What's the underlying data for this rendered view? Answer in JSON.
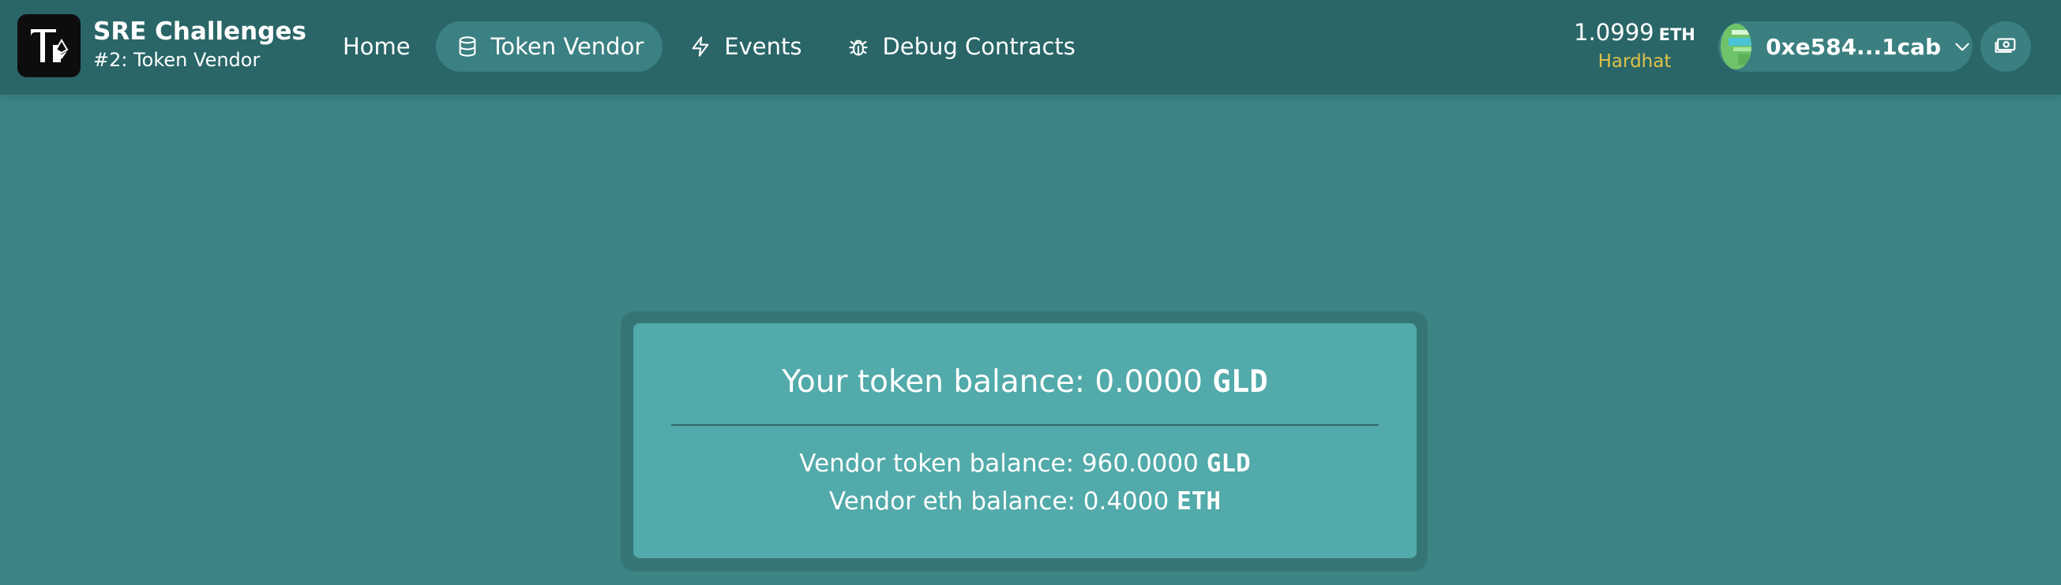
{
  "colors": {
    "background": "#3d8585",
    "header": "#2a6668",
    "active_nav": "#3b8082",
    "card": "#52aaaa",
    "network_label": "#e0c24a"
  },
  "brand": {
    "title": "SRE Challenges",
    "subtitle": "#2: Token Vendor"
  },
  "nav": [
    {
      "label": "Home",
      "icon": "none",
      "active": false
    },
    {
      "label": "Token Vendor",
      "icon": "database-icon",
      "active": true
    },
    {
      "label": "Events",
      "icon": "bolt-icon",
      "active": false
    },
    {
      "label": "Debug Contracts",
      "icon": "bug-icon",
      "active": false
    }
  ],
  "wallet": {
    "balance": "1.0999",
    "unit": "ETH",
    "network": "Hardhat",
    "address": "0xe584...1cab"
  },
  "card": {
    "title_prefix": "Your token balance: 0.0000",
    "title_unit": "GLD",
    "vendor_token_prefix": "Vendor token balance: 960.0000",
    "vendor_token_unit": "GLD",
    "vendor_eth_prefix": "Vendor eth balance: 0.4000",
    "vendor_eth_unit": "ETH"
  }
}
